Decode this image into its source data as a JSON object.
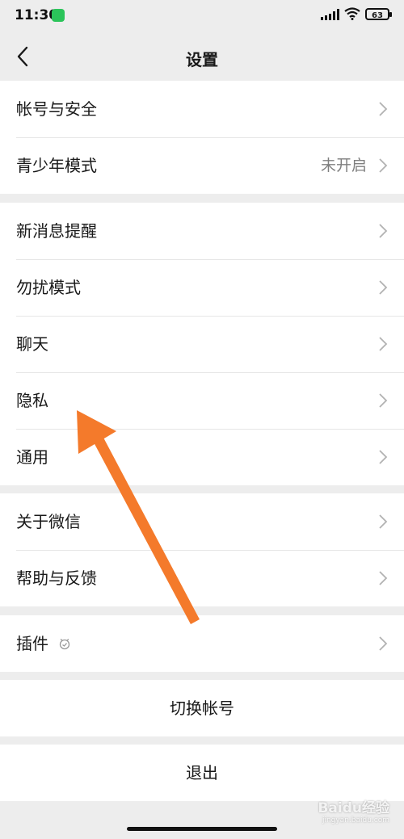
{
  "status_bar": {
    "time": "11:30",
    "battery": "63"
  },
  "nav": {
    "title": "设置"
  },
  "groups": [
    {
      "items": [
        {
          "label": "帐号与安全"
        },
        {
          "label": "青少年模式",
          "value": "未开启"
        }
      ]
    },
    {
      "items": [
        {
          "label": "新消息提醒"
        },
        {
          "label": "勿扰模式"
        },
        {
          "label": "聊天"
        },
        {
          "label": "隐私"
        },
        {
          "label": "通用"
        }
      ]
    },
    {
      "items": [
        {
          "label": "关于微信"
        },
        {
          "label": "帮助与反馈"
        }
      ]
    },
    {
      "items": [
        {
          "label": "插件",
          "icon": "plugin-icon"
        }
      ]
    }
  ],
  "actions": {
    "switch_account": "切换帐号",
    "logout": "退出"
  },
  "watermark": {
    "brand": "Baidu经验",
    "url": "jingyan.baidu.com"
  },
  "annotation": {
    "arrow_color": "#f47a2b"
  }
}
